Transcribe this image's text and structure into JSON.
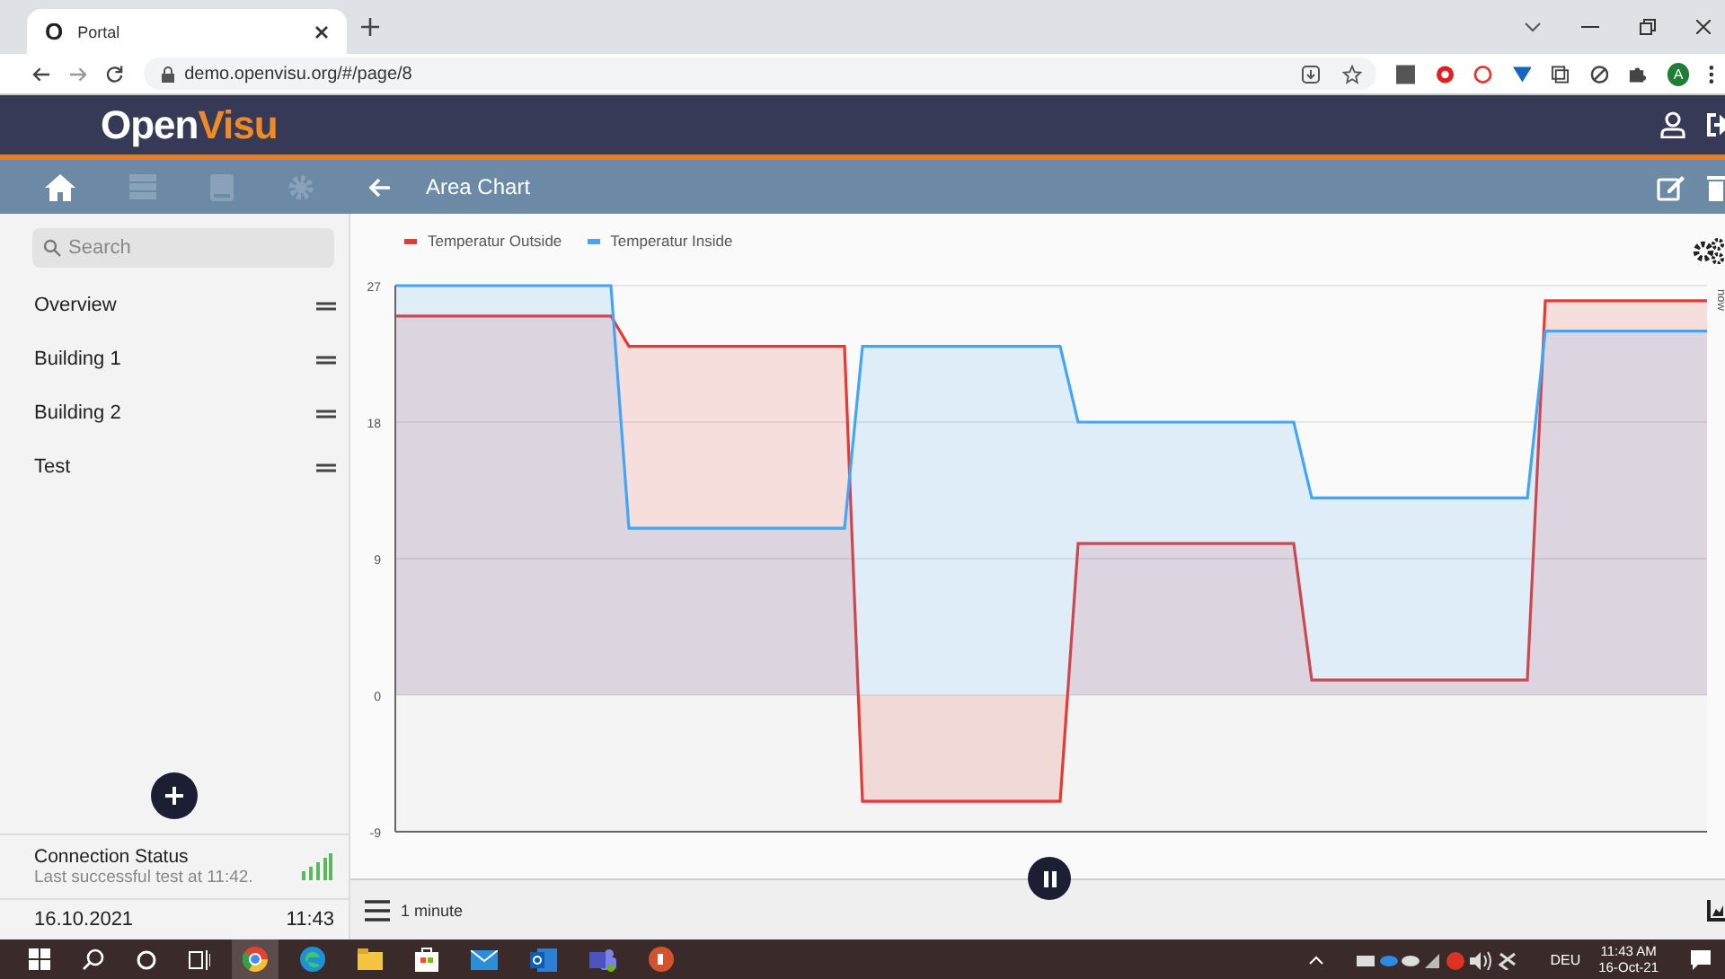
{
  "browser": {
    "tab_icon_letter": "O",
    "tab_title": "Portal",
    "url": "demo.openvisu.org/#/page/8",
    "profile_initial": "A"
  },
  "header": {
    "logo_primary": "Open",
    "logo_accent": "Visu"
  },
  "toolbar": {
    "title": "Area Chart"
  },
  "sidebar": {
    "search": {
      "placeholder": "Search"
    },
    "items": [
      {
        "label": "Overview"
      },
      {
        "label": "Building 1"
      },
      {
        "label": "Building 2"
      },
      {
        "label": "Test"
      }
    ],
    "connection": {
      "title": "Connection Status",
      "detail": "Last successful test at 11:42."
    },
    "date": "16.10.2021",
    "time": "11:43"
  },
  "chart_panel": {
    "end_label": "now",
    "chart_data": {
      "type": "area",
      "categories": [
        null,
        null,
        null,
        null,
        null,
        null,
        null,
        null,
        null,
        null,
        null,
        null,
        null,
        null,
        null,
        null,
        null,
        null,
        null,
        null,
        null,
        null,
        null,
        null,
        null,
        null,
        null,
        null,
        null,
        null,
        null,
        null,
        null,
        null,
        null,
        null,
        null,
        null,
        null,
        null,
        null,
        null,
        null,
        null,
        null,
        null,
        null,
        null,
        null,
        null,
        null,
        null,
        null,
        null,
        null,
        null,
        null,
        null,
        null,
        null,
        null,
        null,
        null,
        null,
        null,
        null,
        null,
        null,
        null,
        null,
        null,
        null,
        null,
        null
      ],
      "series": [
        {
          "name": "Temperatur Outside",
          "color": "#e53935",
          "values": [
            25,
            25,
            25,
            25,
            25,
            25,
            25,
            25,
            25,
            25,
            25,
            25,
            25,
            23,
            23,
            23,
            23,
            23,
            23,
            23,
            23,
            23,
            23,
            23,
            23,
            23,
            -7,
            -7,
            -7,
            -7,
            -7,
            -7,
            -7,
            -7,
            -7,
            -7,
            -7,
            -7,
            10,
            10,
            10,
            10,
            10,
            10,
            10,
            10,
            10,
            10,
            10,
            10,
            10,
            1,
            1,
            1,
            1,
            1,
            1,
            1,
            1,
            1,
            1,
            1,
            1,
            1,
            26,
            26,
            26,
            26,
            26,
            26,
            26,
            26,
            26,
            26
          ]
        },
        {
          "name": "Temperatur Inside",
          "color": "#42a5f5",
          "values": [
            27,
            27,
            27,
            27,
            27,
            27,
            27,
            27,
            27,
            27,
            27,
            27,
            27,
            11,
            11,
            11,
            11,
            11,
            11,
            11,
            11,
            11,
            11,
            11,
            11,
            11,
            23,
            23,
            23,
            23,
            23,
            23,
            23,
            23,
            23,
            23,
            23,
            23,
            18,
            18,
            18,
            18,
            18,
            18,
            18,
            18,
            18,
            18,
            18,
            18,
            18,
            13,
            13,
            13,
            13,
            13,
            13,
            13,
            13,
            13,
            13,
            13,
            13,
            13,
            24,
            24,
            24,
            24,
            24,
            24,
            24,
            24,
            24,
            24
          ]
        }
      ],
      "ylim": [
        -9,
        27
      ],
      "grid": true,
      "yticks": [
        -9,
        0,
        9,
        18,
        27
      ]
    }
  },
  "bottom_bar": {
    "interval": "1 minute"
  },
  "taskbar": {
    "language": "DEU",
    "time": "11:43 AM",
    "date": "16-Oct-21"
  }
}
